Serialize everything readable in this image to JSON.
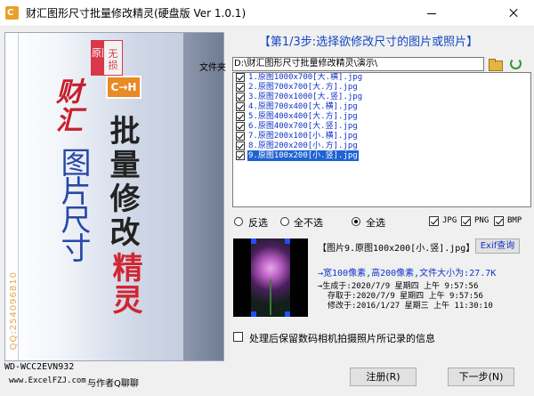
{
  "window": {
    "icon_text": "C",
    "title": "财汇图形尺寸批量修改精灵(硬盘版 Ver 1.0.1)"
  },
  "banner": {
    "logo_a": "原图",
    "logo_b": "无损",
    "logo_ch": "C→H",
    "brand": "财汇",
    "line1": "图片尺寸",
    "line2": "批量修改",
    "line3": "精灵",
    "qq": "QQ:254096810"
  },
  "footer": {
    "machine_id": "WD-WCC2EVN932",
    "url": "www.ExcelFZJ.com",
    "contact": "与作者Q聊聊"
  },
  "step": {
    "title": "【第1/3步:选择欲修改尺寸的图片或照片】"
  },
  "folder": {
    "label": "文件夹",
    "path": "D:\\财汇图形尺寸批量修改精灵\\演示\\"
  },
  "files": [
    "1.原图1000x700[大.横].jpg",
    "2.原图700x700[大.方].jpg",
    "3.原图700x1000[大.竖].jpg",
    "4.原图700x400[大.横].jpg",
    "5.原图400x400[大.方].jpg",
    "6.原图400x700[大.竖].jpg",
    "7.原图200x100[小.横].jpg",
    "8.原图200x200[小.方].jpg",
    "9.原图100x200[小.竖].jpg"
  ],
  "selection": {
    "invert": "反选",
    "none": "全不选",
    "all": "全选",
    "jpg": "JPG",
    "png": "PNG",
    "bmp": "BMP"
  },
  "info": {
    "title": "【图片9.原图100x200[小.竖].jpg】",
    "exif_button": "Exif查询",
    "size": "→宽100像素,高200像素,文件大小为:27.7K",
    "created": "→生成于:2020/7/9 星期四 上午 9:57:56",
    "accessed": "存取于:2020/7/9 星期四 上午 9:57:56",
    "modified": "修改于:2016/1/27 星期三 上午 11:30:10"
  },
  "options": {
    "keep_exif": "处理后保留数码相机拍摄照片所记录的信息"
  },
  "buttons": {
    "register": "注册(R)",
    "next": "下一步(N)"
  },
  "colors": {
    "accent_blue": "#1247c4",
    "selection_blue": "#1e63d2",
    "brand_red": "#d83848"
  }
}
